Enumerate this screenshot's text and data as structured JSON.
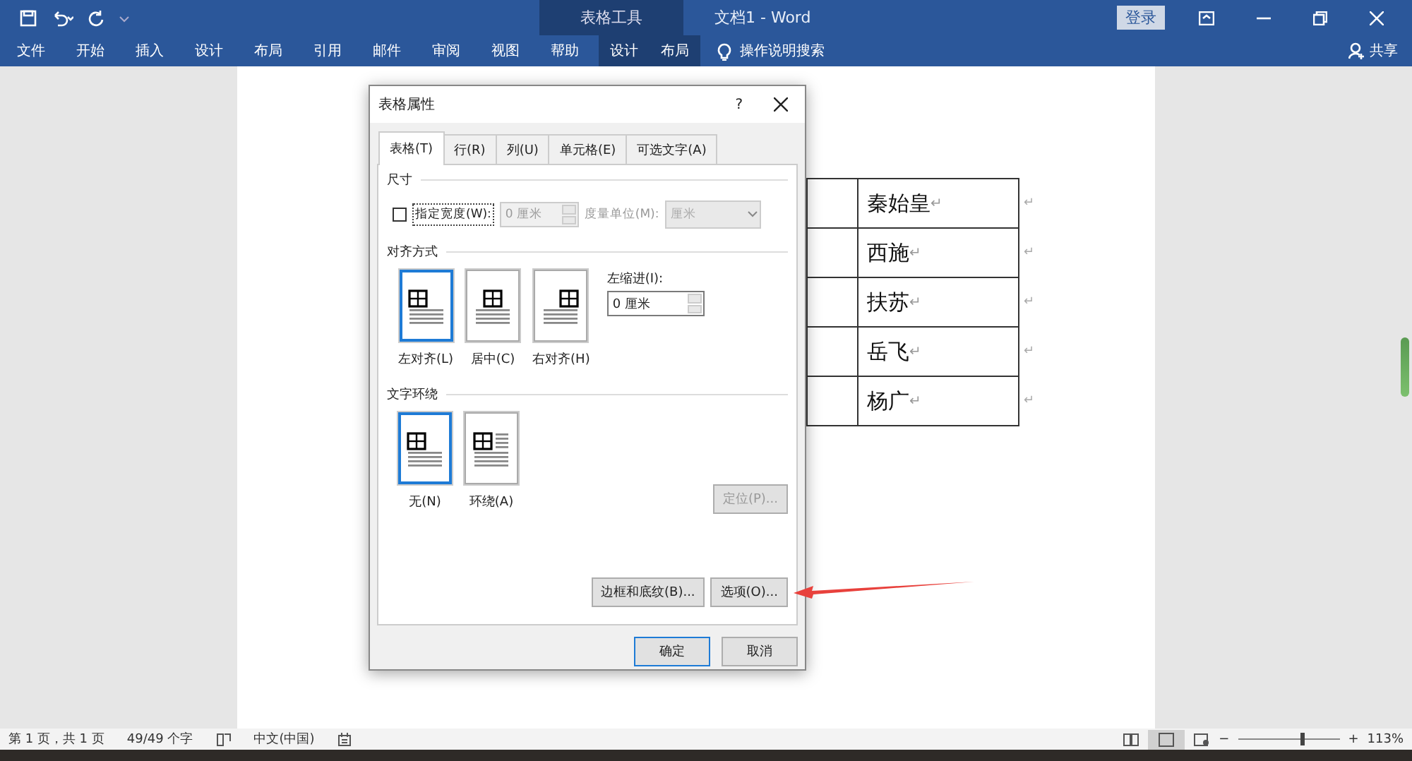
{
  "title_bar": {
    "context_label": "表格工具",
    "document_title": "文档1  -  Word",
    "login_button": "登录"
  },
  "ribbon_tabs": [
    {
      "label": "文件",
      "contextual": false
    },
    {
      "label": "开始",
      "contextual": false
    },
    {
      "label": "插入",
      "contextual": false
    },
    {
      "label": "设计",
      "contextual": false
    },
    {
      "label": "布局",
      "contextual": false
    },
    {
      "label": "引用",
      "contextual": false
    },
    {
      "label": "邮件",
      "contextual": false
    },
    {
      "label": "审阅",
      "contextual": false
    },
    {
      "label": "视图",
      "contextual": false
    },
    {
      "label": "帮助",
      "contextual": false
    },
    {
      "label": "设计",
      "contextual": true
    },
    {
      "label": "布局",
      "contextual": true
    }
  ],
  "tell_me": "操作说明搜索",
  "share": "共享",
  "document_table": {
    "rows": [
      {
        "name": "秦始皇",
        "mark": "↵",
        "end_mark": "↵"
      },
      {
        "name": "西施",
        "mark": "↵",
        "end_mark": "↵"
      },
      {
        "name": "扶苏",
        "mark": "↵",
        "end_mark": "↵"
      },
      {
        "name": "岳飞",
        "mark": "↵",
        "end_mark": "↵"
      },
      {
        "name": "杨广",
        "mark": "↵",
        "end_mark": "↵"
      }
    ]
  },
  "dialog": {
    "title": "表格属性",
    "help": "?",
    "tabs": [
      {
        "label": "表格(T)",
        "selected": true
      },
      {
        "label": "行(R)",
        "selected": false
      },
      {
        "label": "列(U)",
        "selected": false
      },
      {
        "label": "单元格(E)",
        "selected": false
      },
      {
        "label": "可选文字(A)",
        "selected": false
      }
    ],
    "size_section": {
      "heading": "尺寸",
      "width_checkbox": {
        "label": "指定宽度(W):",
        "checked": false
      },
      "width_value": "0 厘米",
      "unit_label": "度量单位(M):",
      "unit_value": "厘米"
    },
    "alignment_section": {
      "heading": "对齐方式",
      "options": [
        {
          "label": "左对齐(L)",
          "kind": "left",
          "selected": true
        },
        {
          "label": "居中(C)",
          "kind": "center",
          "selected": false
        },
        {
          "label": "右对齐(H)",
          "kind": "right",
          "selected": false
        }
      ],
      "indent_label": "左缩进(I):",
      "indent_value": "0 厘米"
    },
    "wrap_section": {
      "heading": "文字环绕",
      "options": [
        {
          "label": "无(N)",
          "kind": "none",
          "selected": true
        },
        {
          "label": "环绕(A)",
          "kind": "around",
          "selected": false
        }
      ],
      "position_button": {
        "label": "定位(P)...",
        "disabled": true
      }
    },
    "borders_button": "边框和底纹(B)...",
    "options_button": "选项(O)...",
    "ok_button": "确定",
    "cancel_button": "取消"
  },
  "status_bar": {
    "page": "第 1 页，共 1 页",
    "words": "49/49 个字",
    "language": "中文(中国)",
    "zoom": {
      "out": "−",
      "in": "+",
      "level": 0.62,
      "reading": "113%"
    }
  }
}
